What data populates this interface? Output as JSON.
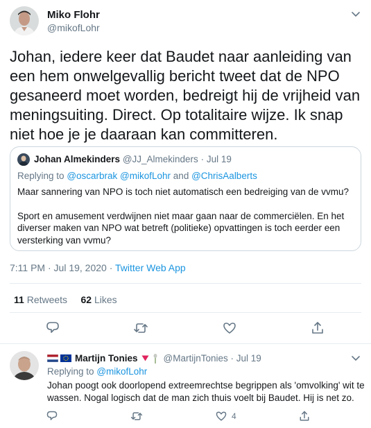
{
  "main_tweet": {
    "author_name": "Miko Flohr",
    "author_handle": "@mikofLohr",
    "text": "Johan, iedere keer dat Baudet naar aanleiding van een hem onwelgevallig bericht tweet dat de NPO gesaneerd moet worden, bedreigt hij de vrijheid van meningsuiting. Direct. Op totalitaire wijze. Ik snap niet hoe je je daaraan kan committeren.",
    "quoted": {
      "author_name": "Johan Almekinders",
      "author_handle": "@JJ_Almekinders",
      "separator": "·",
      "date": "Jul 19",
      "replying_prefix": "Replying to",
      "replying_to": "@oscarbrak @mikofLohr",
      "replying_and": "and",
      "replying_last": "@ChrisAalberts",
      "paragraph1": "Maar sannering van NPO is toch niet automatisch een bedreiging van de vvmu?",
      "paragraph2": "Sport en amusement verdwijnen niet maar gaan naar de commerciëlen. En het diverser maken van NPO wat betreft (politieke) opvattingen is toch eerder een versterking van vvmu?"
    },
    "timestamp": "7:11 PM · Jul 19, 2020 ·",
    "source": "Twitter Web App",
    "retweets_count": "11",
    "retweets_label": "Retweets",
    "likes_count": "62",
    "likes_label": "Likes"
  },
  "reply_tweet": {
    "author_name": "Martijn Tonies",
    "author_handle": "@MartijnTonies",
    "separator": "·",
    "date": "Jul 19",
    "replying_prefix": "Replying to",
    "replying_to": "@mikofLohr",
    "text": "Johan poogt ook doorlopend extreemrechtse begrippen als 'omvolking' wit te wassen. Nogal logisch dat de man zich thuis voelt bij Baudet. Hij is net zo.",
    "like_count": "4"
  },
  "icons": {
    "reply": "reply-icon",
    "retweet": "retweet-icon",
    "like": "heart-icon",
    "share": "share-icon",
    "more": "chevron-down-icon"
  },
  "colors": {
    "link_blue": "#1b95e0",
    "secondary_text": "#657786",
    "icon_gray": "#657786",
    "border": "#ccd6dd"
  }
}
